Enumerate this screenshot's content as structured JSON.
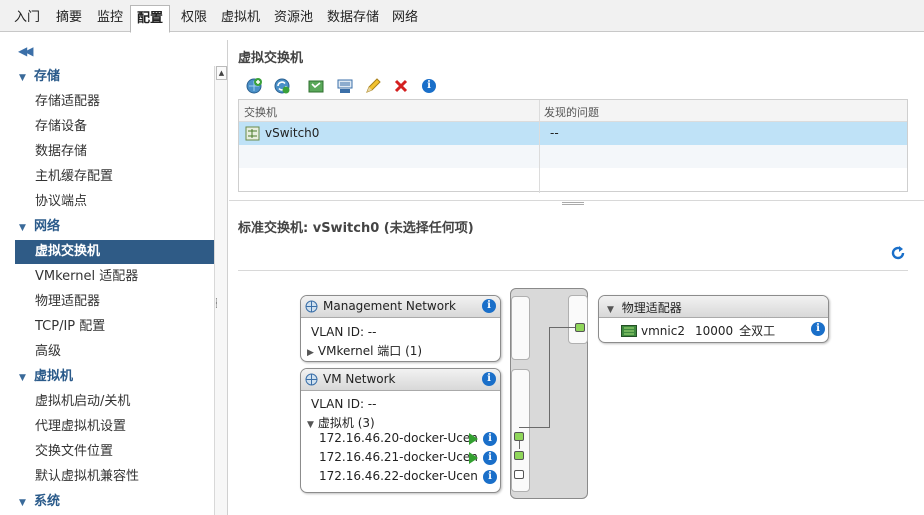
{
  "tabs": [
    {
      "label": "入门"
    },
    {
      "label": "摘要"
    },
    {
      "label": "监控"
    },
    {
      "label": "配置",
      "active": true
    },
    {
      "label": "权限"
    },
    {
      "label": "虚拟机"
    },
    {
      "label": "资源池"
    },
    {
      "label": "数据存储"
    },
    {
      "label": "网络"
    }
  ],
  "sidebar": {
    "collapse_icon": "double-chevron-left-icon",
    "sections": {
      "storage": {
        "label": "存储",
        "items": [
          "存储适配器",
          "存储设备",
          "数据存储",
          "主机缓存配置",
          "协议端点"
        ]
      },
      "network": {
        "label": "网络",
        "items": [
          "虚拟交换机",
          "VMkernel 适配器",
          "物理适配器",
          "TCP/IP 配置",
          "高级"
        ]
      },
      "vm": {
        "label": "虚拟机",
        "items": [
          "虚拟机启动/关机",
          "代理虚拟机设置",
          "交换文件位置",
          "默认虚拟机兼容性"
        ]
      },
      "system": {
        "label": "系统"
      }
    },
    "selected": "虚拟交换机"
  },
  "panel": {
    "title": "虚拟交换机",
    "toolbar": [
      "add-network-icon",
      "refresh-network-icon",
      "migrate-adapter-icon",
      "manage-adapters-icon",
      "edit-pencil-icon",
      "delete-x-icon",
      "info-icon"
    ],
    "grid": {
      "headers": [
        "交换机",
        "发现的问题"
      ],
      "rows": [
        {
          "name": "vSwitch0",
          "issues": "--"
        }
      ]
    }
  },
  "detail": {
    "title": "标准交换机: vSwitch0 (未选择任何项)",
    "mgmt": {
      "title": "Management Network",
      "vlan": "VLAN ID: --",
      "vmk": "VMkernel 端口  (1)"
    },
    "vmnet": {
      "title": "VM Network",
      "vlan": "VLAN ID: --",
      "vms_label": "虚拟机 (3)",
      "vms": [
        "172.16.46.20-docker-Ucen",
        "172.16.46.21-docker-Ucen",
        "172.16.46.22-docker-Ucen"
      ]
    },
    "phys": {
      "title": "物理适配器",
      "nic": "vmnic2",
      "speed": "10000",
      "duplex": "全双工"
    }
  },
  "colors": {
    "selection": "#2f5b86",
    "grid_selection": "#bfe2f7",
    "port_on": "#8fd65a",
    "info": "#1a6fc9"
  }
}
